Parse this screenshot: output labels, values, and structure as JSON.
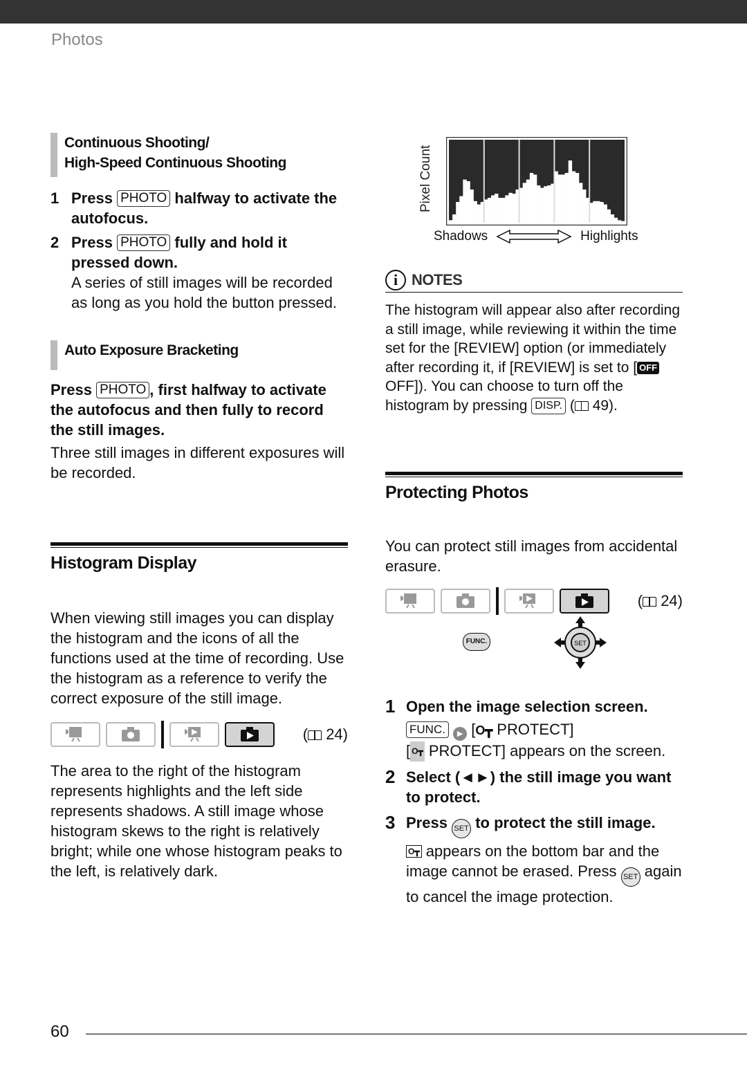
{
  "header": {
    "section": "Photos"
  },
  "left": {
    "continuous": {
      "heading_line1": "Continuous Shooting/",
      "heading_line2": "High-Speed Continuous Shooting",
      "steps": [
        {
          "num": "1",
          "pre": "Press",
          "key": "PHOTO",
          "post": "halfway to activate the autofocus."
        },
        {
          "num": "2",
          "pre": "Press",
          "key": "PHOTO",
          "post": "fully and hold it pressed down.",
          "detail": "A series of still images will be recorded as long as you hold the button pressed."
        }
      ]
    },
    "aeb": {
      "heading": "Auto Exposure Bracketing",
      "pre": "Press",
      "key": "PHOTO",
      "post": ", first halfway to activate the autofocus and then fully to record the still images.",
      "detail": "Three still images in different exposures will be recorded."
    },
    "histogram": {
      "title": "Histogram Display",
      "intro": "When viewing still images you can display the histogram and the icons of all the functions used at the time of recording. Use the histogram as a reference to verify the correct exposure of the still image.",
      "modes": [
        "movie-record",
        "photo-record",
        "movie-playback",
        "photo-playback"
      ],
      "active_mode": "photo-playback",
      "ref_page": "24",
      "explain": "The area to the right of the histogram represents highlights and the left side represents shadows. A still image whose histogram skews to the right is relatively bright; while one whose histogram peaks to the left, is relatively dark."
    }
  },
  "right": {
    "figure": {
      "ylabel": "Pixel Count",
      "left_label": "Shadows",
      "right_label": "Highlights"
    },
    "notes": {
      "title": "NOTES",
      "t1": "The histogram will appear also after recording a still image, while reviewing it within the time set for the [REVIEW] option (or immediately after recording it, if [REVIEW] is set to [",
      "badge": "OFF",
      "t2": " OFF]). You can choose to turn off the histogram by pressing",
      "key": "DISP.",
      "ref_page": "49"
    },
    "protect": {
      "title": "Protecting Photos",
      "intro": "You can protect still images from accidental erasure.",
      "ref_page": "24",
      "func_label": "FUNC.",
      "set_label": "SET",
      "steps": [
        {
          "num": "1",
          "title": "Open the image selection screen.",
          "key": "FUNC.",
          "menu": "PROTECT]",
          "detail_pre": "[",
          "detail_post": "PROTECT] appears on the screen."
        },
        {
          "num": "2",
          "title": "Select (◄►) the still image you want to protect."
        },
        {
          "num": "3",
          "pre": "Press",
          "post": "to protect the still image.",
          "d1": "appears on the bottom bar and the image cannot be erased. Press",
          "d2": "again to cancel the image protection."
        }
      ]
    }
  },
  "footer": {
    "page_number": "60"
  },
  "chart_data": {
    "type": "area",
    "title": "",
    "xlabel": "Shadows ⟷ Highlights",
    "ylabel": "Pixel Count",
    "x": [
      0,
      2,
      4,
      6,
      8,
      10,
      12,
      14,
      16,
      18,
      20,
      22,
      24,
      26,
      28,
      30,
      32,
      34,
      36,
      38,
      40,
      42,
      44,
      46,
      48,
      50,
      52,
      54,
      56,
      58,
      60,
      62,
      64,
      66,
      68,
      70,
      72,
      74,
      76,
      78,
      80,
      82,
      84,
      86,
      88,
      90,
      92,
      94,
      96,
      98,
      100
    ],
    "values": [
      3,
      10,
      25,
      32,
      52,
      50,
      40,
      26,
      22,
      25,
      28,
      30,
      33,
      35,
      30,
      30,
      33,
      36,
      35,
      40,
      42,
      48,
      52,
      60,
      58,
      45,
      42,
      44,
      45,
      47,
      62,
      58,
      58,
      60,
      75,
      62,
      60,
      48,
      40,
      30,
      24,
      26,
      26,
      25,
      22,
      16,
      10,
      6,
      3,
      2,
      2
    ],
    "xlim": [
      0,
      100
    ],
    "ylim": [
      0,
      100
    ],
    "grid": true
  }
}
